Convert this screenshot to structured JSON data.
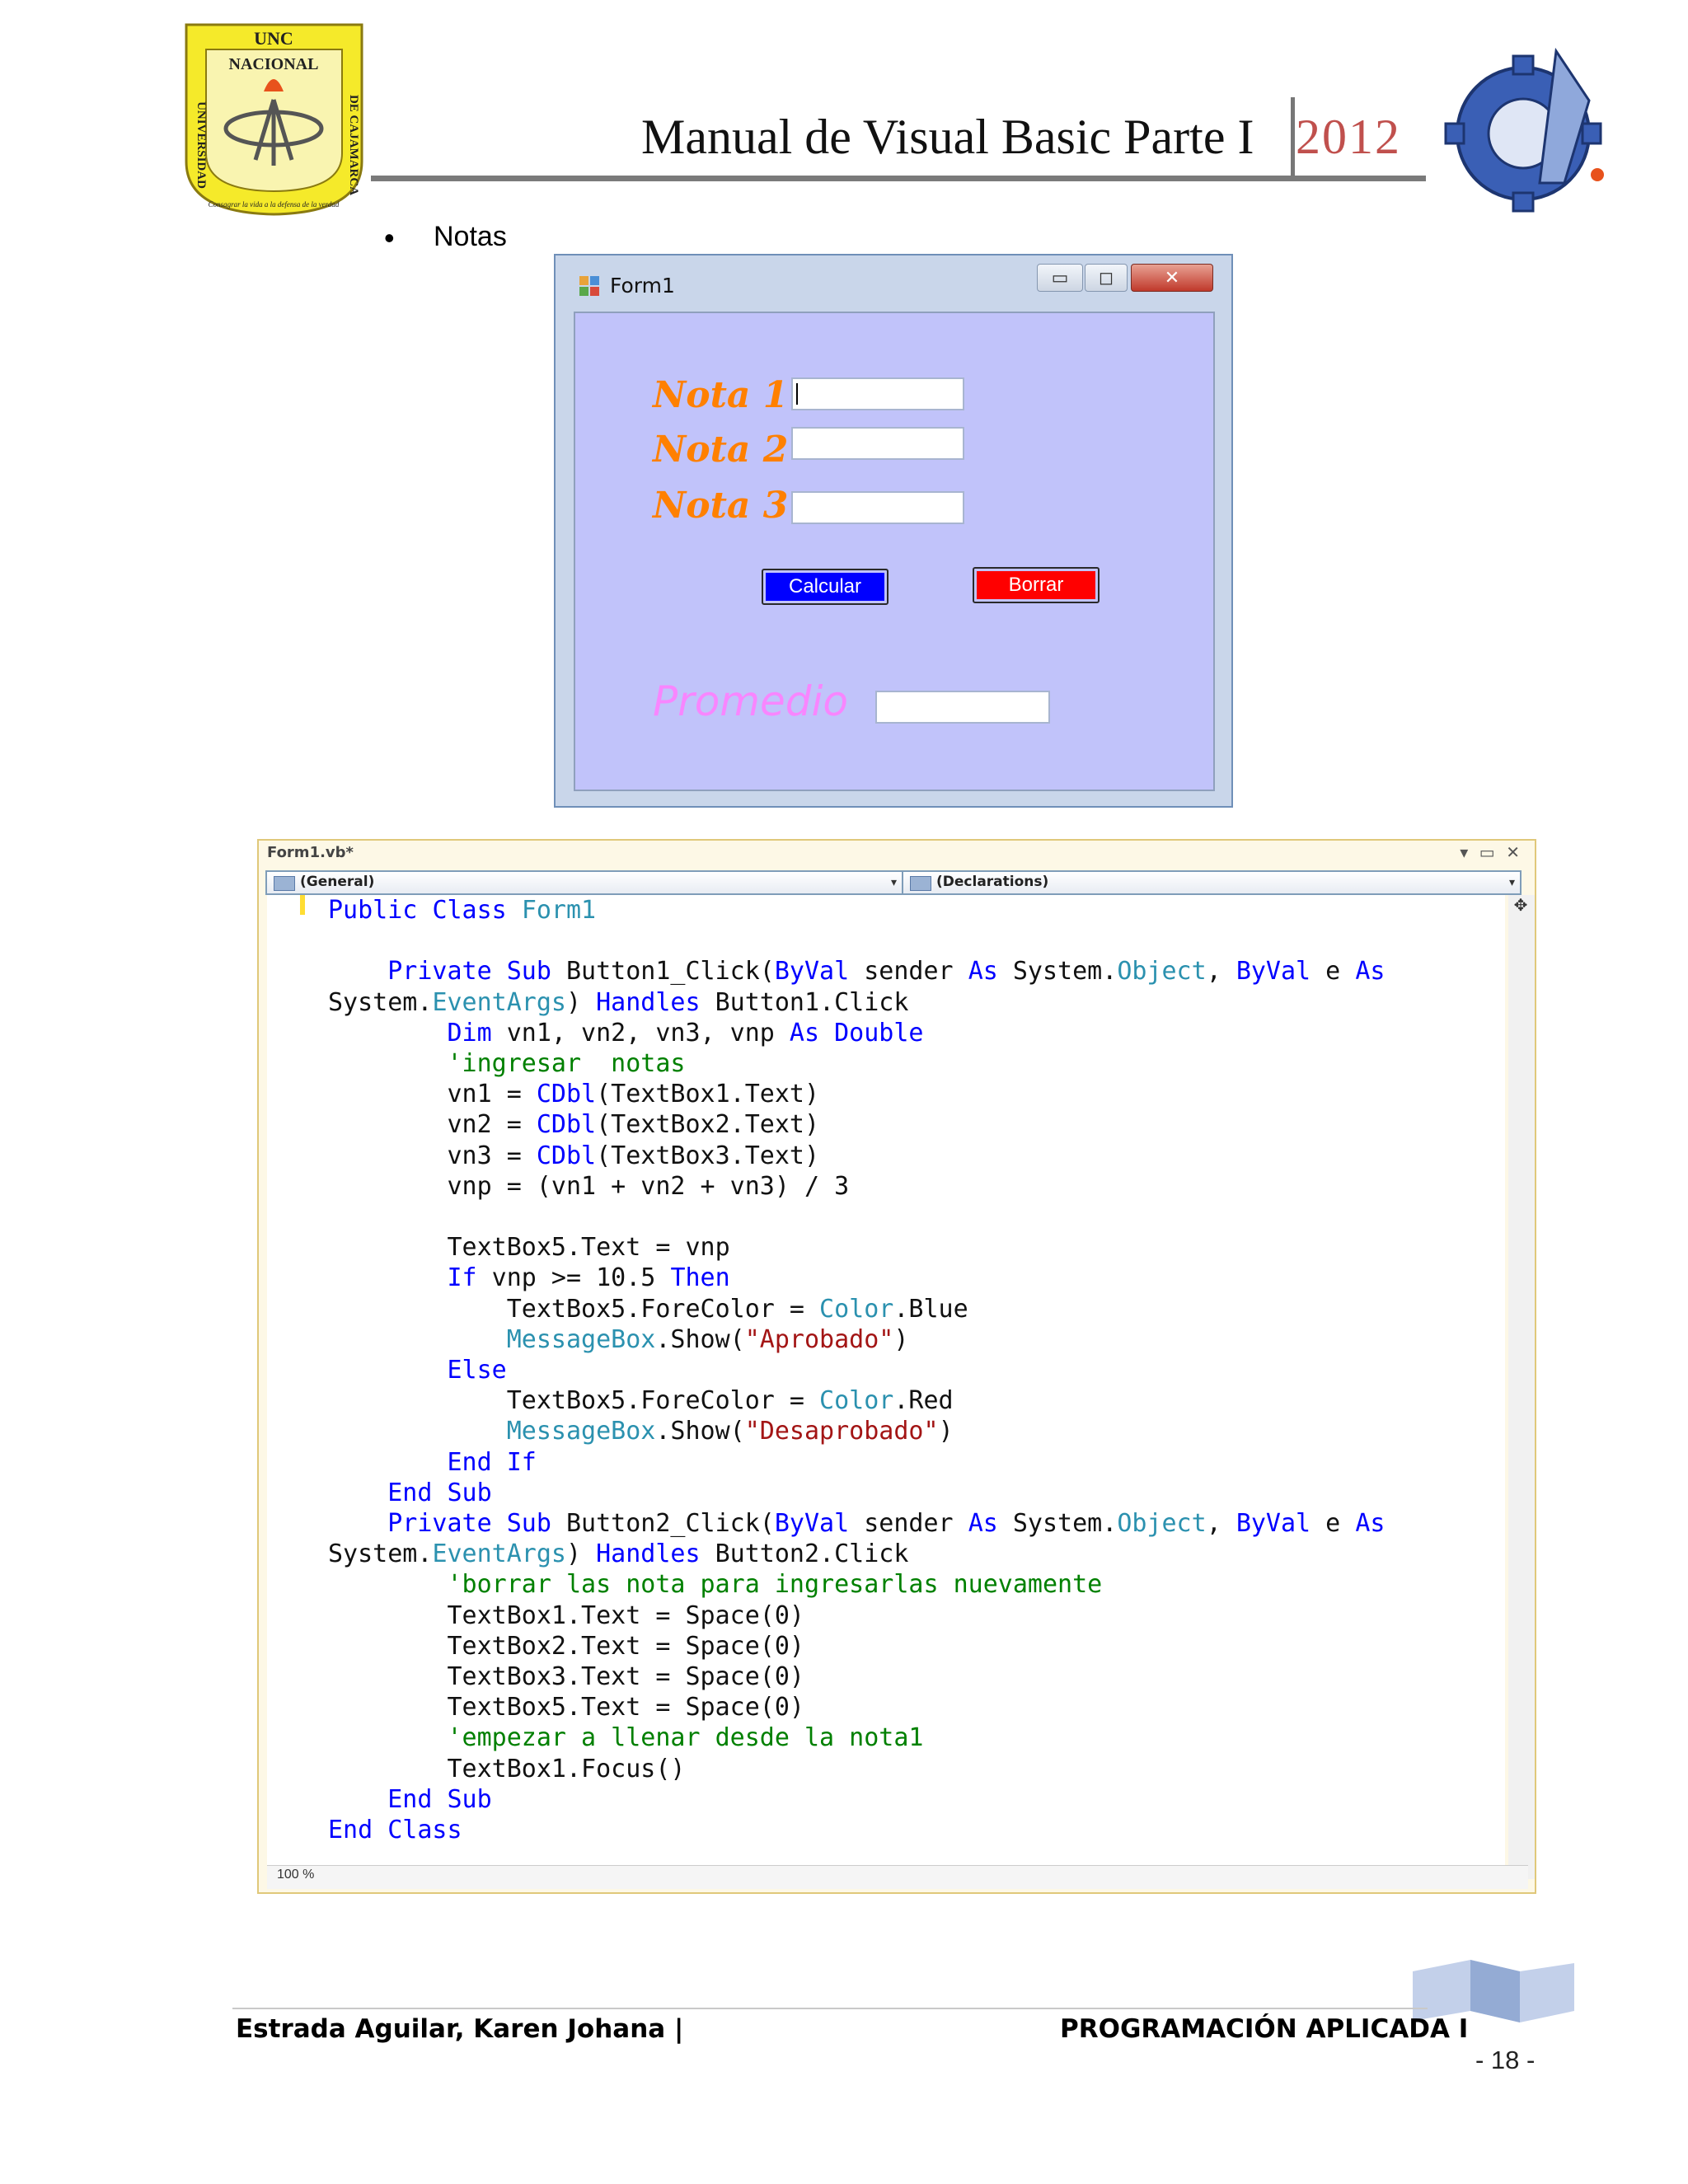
{
  "header": {
    "title": "Manual de Visual Basic Parte I",
    "year": "2012",
    "university_logo": {
      "icon": "university-shield-logo",
      "text_top": "UNC",
      "text_name": "NACIONAL",
      "text_left": "UNIVERSIDAD",
      "text_right": "DE CAJAMARCA",
      "motto": "Consagrar la vida a la defensa de la verdad"
    },
    "school_logo": {
      "icon": "gear-emblem-logo"
    }
  },
  "bullet": {
    "text": "Notas"
  },
  "form_window": {
    "title": "Form1",
    "labels": [
      "Nota 1",
      "Nota 2",
      "Nota 3"
    ],
    "buttons": {
      "calcular": {
        "label": "Calcular",
        "color": "#0000ff"
      },
      "borrar": {
        "label": "Borrar",
        "color": "#ff0000"
      }
    },
    "result_label": "Promedio",
    "colors": {
      "client_bg": "#c1c3fa",
      "label_color": "#ff8000",
      "promedio_color": "#ff80ff"
    }
  },
  "code_editor": {
    "tab": "Form1.vb*",
    "dropdown_left": "(General)",
    "dropdown_right": "(Declarations)",
    "zoom": "100 %",
    "lines": [
      [
        [
          "kw",
          "Public"
        ],
        [
          "t",
          " "
        ],
        [
          "kw",
          "Class"
        ],
        [
          "t",
          " "
        ],
        [
          "ty",
          "Form1"
        ]
      ],
      [],
      [
        [
          "t",
          "    "
        ],
        [
          "kw",
          "Private"
        ],
        [
          "t",
          " "
        ],
        [
          "kw",
          "Sub"
        ],
        [
          "t",
          " Button1_Click("
        ],
        [
          "kw",
          "ByVal"
        ],
        [
          "t",
          " sender "
        ],
        [
          "kw",
          "As"
        ],
        [
          "t",
          " System."
        ],
        [
          "ty",
          "Object"
        ],
        [
          "t",
          ", "
        ],
        [
          "kw",
          "ByVal"
        ],
        [
          "t",
          " e "
        ],
        [
          "kw",
          "As"
        ]
      ],
      [
        [
          "t",
          "System."
        ],
        [
          "ty",
          "EventArgs"
        ],
        [
          "t",
          ") "
        ],
        [
          "kw",
          "Handles"
        ],
        [
          "t",
          " Button1.Click"
        ]
      ],
      [
        [
          "t",
          "        "
        ],
        [
          "kw",
          "Dim"
        ],
        [
          "t",
          " vn1, vn2, vn3, vnp "
        ],
        [
          "kw",
          "As"
        ],
        [
          "t",
          " "
        ],
        [
          "kw",
          "Double"
        ]
      ],
      [
        [
          "t",
          "        "
        ],
        [
          "cm",
          "'ingresar  notas"
        ]
      ],
      [
        [
          "t",
          "        vn1 = "
        ],
        [
          "kw",
          "CDbl"
        ],
        [
          "t",
          "(TextBox1.Text)"
        ]
      ],
      [
        [
          "t",
          "        vn2 = "
        ],
        [
          "kw",
          "CDbl"
        ],
        [
          "t",
          "(TextBox2.Text)"
        ]
      ],
      [
        [
          "t",
          "        vn3 = "
        ],
        [
          "kw",
          "CDbl"
        ],
        [
          "t",
          "(TextBox3.Text)"
        ]
      ],
      [
        [
          "t",
          "        vnp = (vn1 + vn2 + vn3) / 3"
        ]
      ],
      [],
      [
        [
          "t",
          "        TextBox5.Text = vnp"
        ]
      ],
      [
        [
          "t",
          "        "
        ],
        [
          "kw",
          "If"
        ],
        [
          "t",
          " vnp >= 10.5 "
        ],
        [
          "kw",
          "Then"
        ]
      ],
      [
        [
          "t",
          "            TextBox5.ForeColor = "
        ],
        [
          "ty",
          "Color"
        ],
        [
          "t",
          ".Blue"
        ]
      ],
      [
        [
          "t",
          "            "
        ],
        [
          "ty",
          "MessageBox"
        ],
        [
          "t",
          ".Show("
        ],
        [
          "str",
          "\"Aprobado\""
        ],
        [
          "t",
          ")"
        ]
      ],
      [
        [
          "t",
          "        "
        ],
        [
          "kw",
          "Else"
        ]
      ],
      [
        [
          "t",
          "            TextBox5.ForeColor = "
        ],
        [
          "ty",
          "Color"
        ],
        [
          "t",
          ".Red"
        ]
      ],
      [
        [
          "t",
          "            "
        ],
        [
          "ty",
          "MessageBox"
        ],
        [
          "t",
          ".Show("
        ],
        [
          "str",
          "\"Desaprobado\""
        ],
        [
          "t",
          ")"
        ]
      ],
      [
        [
          "t",
          "        "
        ],
        [
          "kw",
          "End If"
        ]
      ],
      [
        [
          "t",
          "    "
        ],
        [
          "kw",
          "End Sub"
        ]
      ],
      [
        [
          "t",
          "    "
        ],
        [
          "kw",
          "Private"
        ],
        [
          "t",
          " "
        ],
        [
          "kw",
          "Sub"
        ],
        [
          "t",
          " Button2_Click("
        ],
        [
          "kw",
          "ByVal"
        ],
        [
          "t",
          " sender "
        ],
        [
          "kw",
          "As"
        ],
        [
          "t",
          " System."
        ],
        [
          "ty",
          "Object"
        ],
        [
          "t",
          ", "
        ],
        [
          "kw",
          "ByVal"
        ],
        [
          "t",
          " e "
        ],
        [
          "kw",
          "As"
        ]
      ],
      [
        [
          "t",
          "System."
        ],
        [
          "ty",
          "EventArgs"
        ],
        [
          "t",
          ") "
        ],
        [
          "kw",
          "Handles"
        ],
        [
          "t",
          " Button2.Click"
        ]
      ],
      [
        [
          "t",
          "        "
        ],
        [
          "cm",
          "'borrar las nota para ingresarlas nuevamente"
        ]
      ],
      [
        [
          "t",
          "        TextBox1.Text = Space(0)"
        ]
      ],
      [
        [
          "t",
          "        TextBox2.Text = Space(0)"
        ]
      ],
      [
        [
          "t",
          "        TextBox3.Text = Space(0)"
        ]
      ],
      [
        [
          "t",
          "        TextBox5.Text = Space(0)"
        ]
      ],
      [
        [
          "t",
          "        "
        ],
        [
          "cm",
          "'empezar a llenar desde la nota1"
        ]
      ],
      [
        [
          "t",
          "        TextBox1.Focus()"
        ]
      ],
      [
        [
          "t",
          "    "
        ],
        [
          "kw",
          "End Sub"
        ]
      ],
      [
        [
          "kw",
          "End Class"
        ]
      ]
    ]
  },
  "footer": {
    "left": "Estrada Aguilar, Karen Johana |",
    "right": "PROGRAMACIÓN APLICADA I",
    "page": "- 18 -"
  }
}
